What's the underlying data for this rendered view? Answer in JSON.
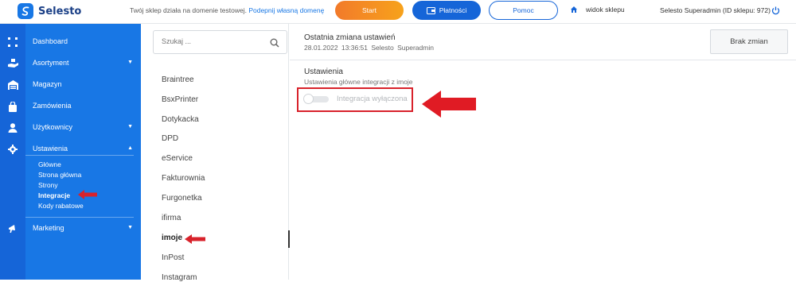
{
  "brand": {
    "name": "Selesto",
    "icon": "selesto-logo-icon"
  },
  "topbar": {
    "notice_text": "Twój sklep działa na domenie testowej.",
    "notice_link": "Podepnij własną domenę",
    "start_label": "Start",
    "payments_label": "Płatności",
    "help_label": "Pomoc",
    "shop_view_label": "widok sklepu",
    "user_label": "Selesto Superadmin (ID sklepu: 972)",
    "colors": {
      "start": "#f27a2a",
      "payments": "#1565d8",
      "sidebar": "#1877e5",
      "highlight": "#d8222b"
    }
  },
  "sidebar": {
    "items": [
      {
        "label": "Dashboard",
        "icon": "grid-icon",
        "caret": ""
      },
      {
        "label": "Asortyment",
        "icon": "hand-box-icon",
        "caret": "▼"
      },
      {
        "label": "Magazyn",
        "icon": "warehouse-icon",
        "caret": ""
      },
      {
        "label": "Zamówienia",
        "icon": "bag-icon",
        "caret": ""
      },
      {
        "label": "Użytkownicy",
        "icon": "user-icon",
        "caret": "▼"
      },
      {
        "label": "Ustawienia",
        "icon": "gear-icon",
        "caret": "▲"
      },
      {
        "label": "Marketing",
        "icon": "megaphone-icon",
        "caret": "▼"
      }
    ],
    "settings_sub": [
      "Główne",
      "Strona główna",
      "Strony",
      "Integracje",
      "Kody rabatowe"
    ],
    "active_sub": "Integracje"
  },
  "search": {
    "placeholder": "Szukaj ..."
  },
  "integrations": [
    "Braintree",
    "BsxPrinter",
    "Dotykacka",
    "DPD",
    "eService",
    "Fakturownia",
    "Furgonetka",
    "ifirma",
    "imoje",
    "InPost",
    "Instagram"
  ],
  "active_integration": "imoje",
  "main": {
    "changed_title": "Ostatnia zmiana ustawień",
    "changed_date": "28.01.2022",
    "changed_time": "13:36:51",
    "changed_user": "Selesto Superadmin",
    "no_changes_label": "Brak zmian",
    "section_title": "Ustawienia",
    "section_subtitle": "Ustawienia główne integracji z imoje",
    "toggle_label": "Integracja wyłączona",
    "toggle_on": false
  }
}
